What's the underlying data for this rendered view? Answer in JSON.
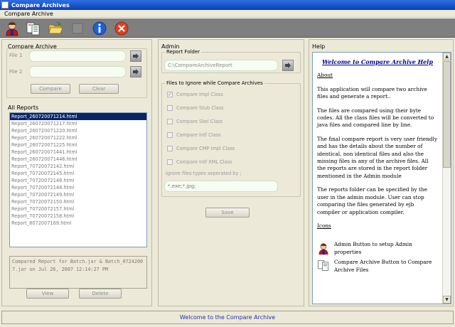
{
  "window": {
    "title": "Compare Archives"
  },
  "menu": {
    "items": [
      "Compare Archive"
    ]
  },
  "toolbar": {
    "buttons": [
      {
        "name": "admin-button",
        "icon": "admin-user-icon"
      },
      {
        "name": "compare-archive-button",
        "icon": "compare-archive-icon"
      },
      {
        "name": "open-folder-button",
        "icon": "open-folder-icon"
      },
      {
        "name": "disabled-button",
        "icon": "disabled-tool-icon"
      },
      {
        "name": "info-button",
        "icon": "info-icon"
      },
      {
        "name": "exit-button",
        "icon": "close-icon"
      }
    ]
  },
  "compare_archive": {
    "title": "Compare Archive",
    "file1_label": "File 1",
    "file2_label": "File 2",
    "file1_value": "",
    "file2_value": "",
    "compare_label": "Compare",
    "clear_label": "Clear"
  },
  "all_reports": {
    "title": "All Reports",
    "items": [
      "Report_260720071214.html",
      "Report_260720071217.html",
      "Report_260720071220.html",
      "Report_260720071222.html",
      "Report_260720071225.html",
      "Report_260720071441.html",
      "Report_260720071446.html",
      "Report_70720072142.html",
      "Report_70720072145.html",
      "Report_70720072146.html",
      "Report_70720072148.html",
      "Report_70720072149.html",
      "Report_70720072150.html",
      "Report_70720072157.html",
      "Report_70720072158.html",
      "Report_8072007169.html"
    ],
    "selected_index": 0,
    "details": "Compared Report for Batch.jar & Batch_07242007.jar on Jul 26, 2007 12:14:27 PM",
    "view_label": "View",
    "delete_label": "Delete"
  },
  "admin": {
    "title": "Admin",
    "report_folder_title": "Report Folder",
    "report_folder_value": "C:\\CompareArchiveReport",
    "ignore_title": "Files to Ignore while Compare Archives",
    "options": [
      {
        "label": "Compare Impl Class",
        "checked": true
      },
      {
        "label": "Compare Stub Class",
        "checked": false
      },
      {
        "label": "Compare Skel Class",
        "checked": false
      },
      {
        "label": "Compare Intf Class",
        "checked": false
      },
      {
        "label": "Compare CMP Impl Class",
        "checked": false
      },
      {
        "label": "Compare Intf XML Class",
        "checked": false
      }
    ],
    "ignore_types_label": "Ignore files types seperated by ;",
    "ignore_types_value": "*.exe;*.jpg;",
    "save_label": "Save"
  },
  "help": {
    "title": "Help",
    "heading": "Welcome to Compare Archive Help",
    "about_label": "About",
    "paragraphs": [
      "This application will compare two archive files and generate a report..",
      "The files are compared using their byte codes. All the class files will be converted to java files and compared line by line.",
      "The final compare report is very user friendly and has the details about the number of identical, non identical files and also the missing files in any of the archive files.  All the reports are stored in the report folder mentioned in the Admin module",
      "The reports folder can be specified by the user in the admin module. User can stop comparing the files generated by ejb compiler or application compiler."
    ],
    "icons_label": "Icons",
    "icon_entries": [
      {
        "icon": "admin-user-icon",
        "text": "Admin Button to setup Admin properties"
      },
      {
        "icon": "compare-archive-icon",
        "text": "Compare Archive Button to Compare Archive Files"
      }
    ]
  },
  "status": {
    "text": "Welcome to the Compare Archive"
  }
}
